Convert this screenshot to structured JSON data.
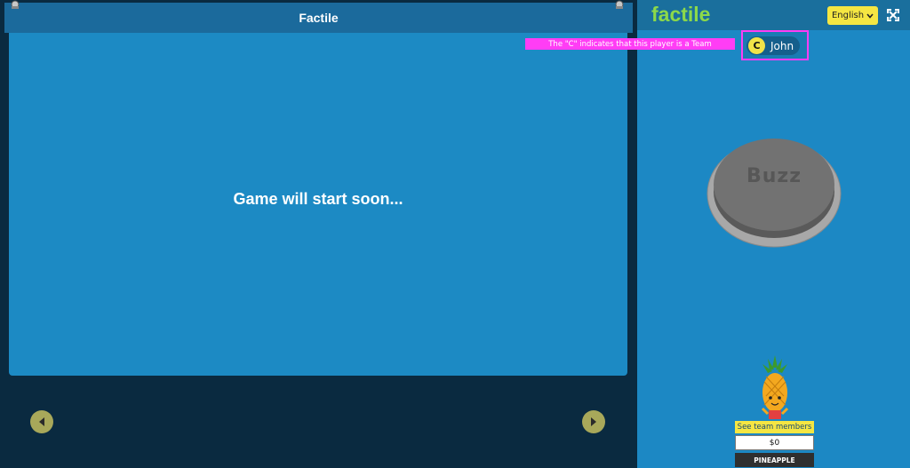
{
  "game": {
    "title": "Factile",
    "status_message": "Game will start soon...",
    "nav_prev_icon": "arrow-left-icon",
    "nav_next_icon": "arrow-right-icon"
  },
  "sidebar": {
    "logo_text": "factile",
    "language": {
      "selected": "English",
      "icon": "chevron-down-icon"
    },
    "fullscreen_icon": "expand-icon",
    "annotation": "The \"C\" indicates that this player is a Team",
    "player": {
      "badge": "C",
      "name": "John"
    },
    "buzz_label": "Buzz",
    "team": {
      "see_members_label": "See team members",
      "score": "$0",
      "name": "PINEAPPLE"
    }
  },
  "colors": {
    "board_blue": "#1c8ac4",
    "header_blue": "#1b6a9c",
    "logo_green": "#8cd94a",
    "accent_yellow": "#f5e642",
    "annotation_magenta": "#ff3df5",
    "dark_navy": "#0a2a40"
  }
}
